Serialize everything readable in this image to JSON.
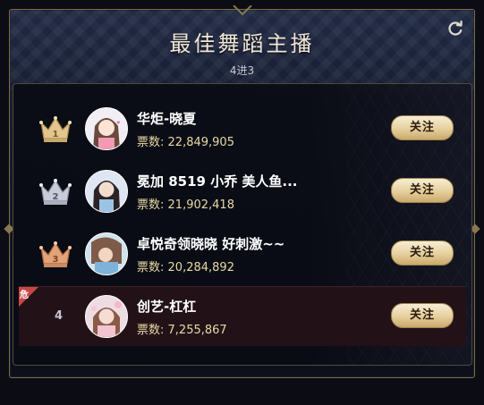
{
  "header": {
    "title": "最佳舞蹈主播",
    "subtitle": "4进3"
  },
  "colors": {
    "gold": "#e2c58f",
    "silver": "#c7ccd8",
    "bronze": "#e3a277",
    "danger": "#c94646",
    "votes_text": "#e9d9a5"
  },
  "rankings": [
    {
      "rank_label": "1",
      "rank_icon": "gold-crown-icon",
      "name": "华炬-晓夏",
      "votes_label": "票数:",
      "votes": "22,849,905",
      "follow_label": "关注",
      "danger": false
    },
    {
      "rank_label": "2",
      "rank_icon": "silver-crown-icon",
      "name": "冕加 8519 小乔 美人鱼...",
      "votes_label": "票数:",
      "votes": "21,902,418",
      "follow_label": "关注",
      "danger": false
    },
    {
      "rank_label": "3",
      "rank_icon": "bronze-crown-icon",
      "name": "卓悦奇领晓晓 好刺激~~",
      "votes_label": "票数:",
      "votes": "20,284,892",
      "follow_label": "关注",
      "danger": false
    },
    {
      "rank_label": "4",
      "rank_icon": "",
      "name": "创艺-杠杠",
      "votes_label": "票数:",
      "votes": "7,255,867",
      "follow_label": "关注",
      "danger": true,
      "danger_label": "危"
    }
  ]
}
